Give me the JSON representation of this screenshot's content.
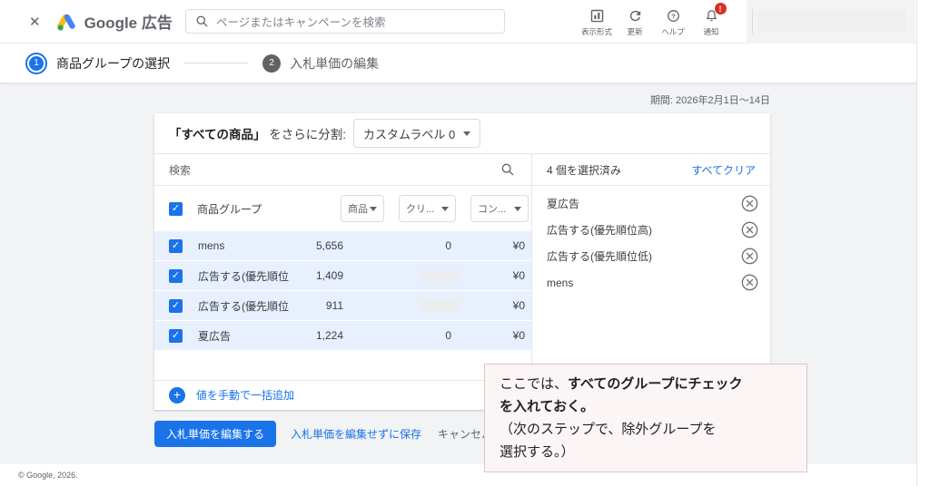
{
  "topbar": {
    "brand": "Google 広告",
    "search_placeholder": "ページまたはキャンペーンを検索",
    "actions": [
      {
        "label": "表示形式"
      },
      {
        "label": "更新"
      },
      {
        "label": "ヘルプ"
      },
      {
        "label": "通知",
        "badge": "!"
      }
    ]
  },
  "steps": [
    {
      "number": "1",
      "label": "商品グループの選択"
    },
    {
      "number": "2",
      "label": "入札単価の編集"
    }
  ],
  "period": "期間: 2026年2月1日〜14日",
  "panel": {
    "split": {
      "target": "「すべての商品」",
      "suffix": " をさらに分割:",
      "dropdown": "カスタムラベル 0"
    },
    "search_placeholder": "検索",
    "table": {
      "group_header": "商品グループ",
      "column_dropdowns": [
        "商品",
        "クリ...",
        "コン..."
      ],
      "rows": [
        {
          "name": "mens",
          "impressions": "5,656",
          "clicks": "0",
          "cost": "¥0"
        },
        {
          "name": "広告する(優先順位低)",
          "impressions": "1,409",
          "clicks": "",
          "cost": "¥0"
        },
        {
          "name": "広告する(優先順位高)",
          "impressions": "911",
          "clicks": "",
          "cost": "¥0"
        },
        {
          "name": "夏広告",
          "impressions": "1,224",
          "clicks": "0",
          "cost": "¥0"
        }
      ]
    },
    "add_values_label": "値を手動で一括追加",
    "selected": {
      "count_label": "4 個を選択済み",
      "clear_all_label": "すべてクリア",
      "items": [
        "夏広告",
        "広告する(優先順位高)",
        "広告する(優先順位低)",
        "mens"
      ]
    }
  },
  "buttons": {
    "primary": "入札単価を編集する",
    "secondary": "入札単価を編集せずに保存",
    "cancel": "キャンセル"
  },
  "annotation": {
    "line1_normal": "ここでは、",
    "line1_bold": "すべてのグループにチェック",
    "line2_bold": "を入れておく。",
    "line3": "（次のステップで、除外グループを",
    "line4": "選択する。）"
  },
  "footer": {
    "copyright": "© Google, 2026."
  },
  "colors": {
    "accent_blue": "#1a73e8",
    "selected_row_bg": "#e8f0fe",
    "notification_badge_red": "#d93025",
    "annotation_border_pink": "#dfc5c5",
    "background_gray": "#f1f3f4"
  }
}
